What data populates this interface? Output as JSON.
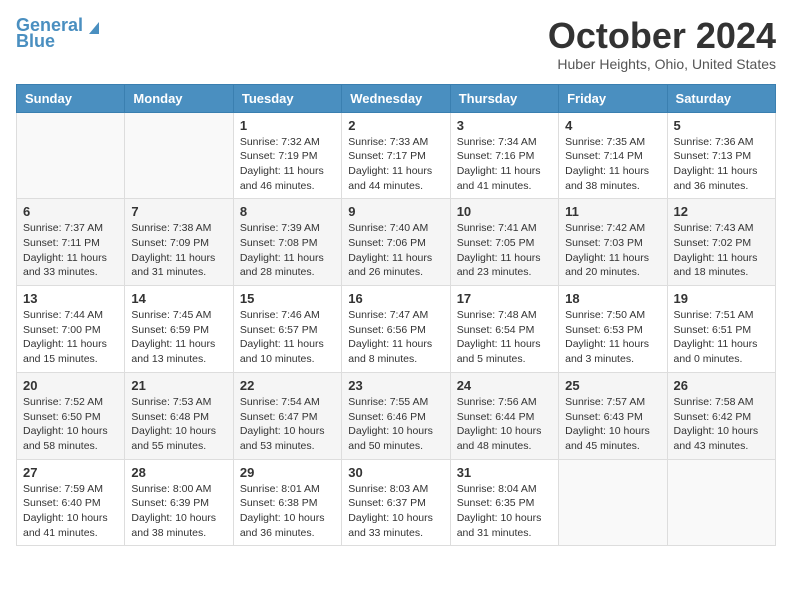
{
  "header": {
    "logo_line1": "General",
    "logo_line2": "Blue",
    "month_title": "October 2024",
    "location": "Huber Heights, Ohio, United States"
  },
  "days_of_week": [
    "Sunday",
    "Monday",
    "Tuesday",
    "Wednesday",
    "Thursday",
    "Friday",
    "Saturday"
  ],
  "weeks": [
    [
      {
        "day": "",
        "info": ""
      },
      {
        "day": "",
        "info": ""
      },
      {
        "day": "1",
        "info": "Sunrise: 7:32 AM\nSunset: 7:19 PM\nDaylight: 11 hours and 46 minutes."
      },
      {
        "day": "2",
        "info": "Sunrise: 7:33 AM\nSunset: 7:17 PM\nDaylight: 11 hours and 44 minutes."
      },
      {
        "day": "3",
        "info": "Sunrise: 7:34 AM\nSunset: 7:16 PM\nDaylight: 11 hours and 41 minutes."
      },
      {
        "day": "4",
        "info": "Sunrise: 7:35 AM\nSunset: 7:14 PM\nDaylight: 11 hours and 38 minutes."
      },
      {
        "day": "5",
        "info": "Sunrise: 7:36 AM\nSunset: 7:13 PM\nDaylight: 11 hours and 36 minutes."
      }
    ],
    [
      {
        "day": "6",
        "info": "Sunrise: 7:37 AM\nSunset: 7:11 PM\nDaylight: 11 hours and 33 minutes."
      },
      {
        "day": "7",
        "info": "Sunrise: 7:38 AM\nSunset: 7:09 PM\nDaylight: 11 hours and 31 minutes."
      },
      {
        "day": "8",
        "info": "Sunrise: 7:39 AM\nSunset: 7:08 PM\nDaylight: 11 hours and 28 minutes."
      },
      {
        "day": "9",
        "info": "Sunrise: 7:40 AM\nSunset: 7:06 PM\nDaylight: 11 hours and 26 minutes."
      },
      {
        "day": "10",
        "info": "Sunrise: 7:41 AM\nSunset: 7:05 PM\nDaylight: 11 hours and 23 minutes."
      },
      {
        "day": "11",
        "info": "Sunrise: 7:42 AM\nSunset: 7:03 PM\nDaylight: 11 hours and 20 minutes."
      },
      {
        "day": "12",
        "info": "Sunrise: 7:43 AM\nSunset: 7:02 PM\nDaylight: 11 hours and 18 minutes."
      }
    ],
    [
      {
        "day": "13",
        "info": "Sunrise: 7:44 AM\nSunset: 7:00 PM\nDaylight: 11 hours and 15 minutes."
      },
      {
        "day": "14",
        "info": "Sunrise: 7:45 AM\nSunset: 6:59 PM\nDaylight: 11 hours and 13 minutes."
      },
      {
        "day": "15",
        "info": "Sunrise: 7:46 AM\nSunset: 6:57 PM\nDaylight: 11 hours and 10 minutes."
      },
      {
        "day": "16",
        "info": "Sunrise: 7:47 AM\nSunset: 6:56 PM\nDaylight: 11 hours and 8 minutes."
      },
      {
        "day": "17",
        "info": "Sunrise: 7:48 AM\nSunset: 6:54 PM\nDaylight: 11 hours and 5 minutes."
      },
      {
        "day": "18",
        "info": "Sunrise: 7:50 AM\nSunset: 6:53 PM\nDaylight: 11 hours and 3 minutes."
      },
      {
        "day": "19",
        "info": "Sunrise: 7:51 AM\nSunset: 6:51 PM\nDaylight: 11 hours and 0 minutes."
      }
    ],
    [
      {
        "day": "20",
        "info": "Sunrise: 7:52 AM\nSunset: 6:50 PM\nDaylight: 10 hours and 58 minutes."
      },
      {
        "day": "21",
        "info": "Sunrise: 7:53 AM\nSunset: 6:48 PM\nDaylight: 10 hours and 55 minutes."
      },
      {
        "day": "22",
        "info": "Sunrise: 7:54 AM\nSunset: 6:47 PM\nDaylight: 10 hours and 53 minutes."
      },
      {
        "day": "23",
        "info": "Sunrise: 7:55 AM\nSunset: 6:46 PM\nDaylight: 10 hours and 50 minutes."
      },
      {
        "day": "24",
        "info": "Sunrise: 7:56 AM\nSunset: 6:44 PM\nDaylight: 10 hours and 48 minutes."
      },
      {
        "day": "25",
        "info": "Sunrise: 7:57 AM\nSunset: 6:43 PM\nDaylight: 10 hours and 45 minutes."
      },
      {
        "day": "26",
        "info": "Sunrise: 7:58 AM\nSunset: 6:42 PM\nDaylight: 10 hours and 43 minutes."
      }
    ],
    [
      {
        "day": "27",
        "info": "Sunrise: 7:59 AM\nSunset: 6:40 PM\nDaylight: 10 hours and 41 minutes."
      },
      {
        "day": "28",
        "info": "Sunrise: 8:00 AM\nSunset: 6:39 PM\nDaylight: 10 hours and 38 minutes."
      },
      {
        "day": "29",
        "info": "Sunrise: 8:01 AM\nSunset: 6:38 PM\nDaylight: 10 hours and 36 minutes."
      },
      {
        "day": "30",
        "info": "Sunrise: 8:03 AM\nSunset: 6:37 PM\nDaylight: 10 hours and 33 minutes."
      },
      {
        "day": "31",
        "info": "Sunrise: 8:04 AM\nSunset: 6:35 PM\nDaylight: 10 hours and 31 minutes."
      },
      {
        "day": "",
        "info": ""
      },
      {
        "day": "",
        "info": ""
      }
    ]
  ]
}
